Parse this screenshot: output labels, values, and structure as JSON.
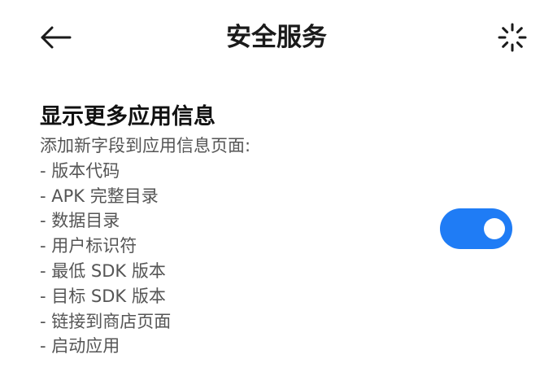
{
  "header": {
    "title": "安全服务",
    "back_icon": "arrow-left-icon",
    "action_icon": "loading-spinner-icon"
  },
  "setting": {
    "title": "显示更多应用信息",
    "description_intro": "添加新字段到应用信息页面:",
    "items": [
      "- 版本代码",
      "- APK 完整目录",
      "- 数据目录",
      "- 用户标识符",
      "- 最低 SDK 版本",
      "- 目标 SDK 版本",
      "- 链接到商店页面",
      "- 启动应用"
    ],
    "toggle_on": true
  },
  "colors": {
    "accent": "#1f7cf5",
    "title_text": "#1a1a1a",
    "secondary_text": "#555555",
    "background": "#ffffff"
  }
}
